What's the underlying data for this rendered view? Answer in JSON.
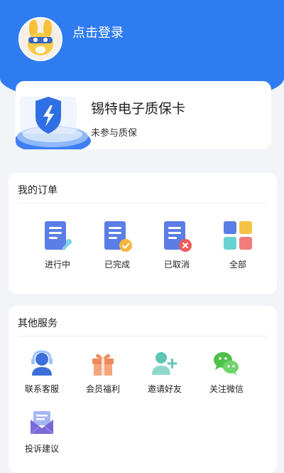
{
  "header": {
    "login_label": "点击登录",
    "accent_color": "#2f7cf0"
  },
  "warranty_card": {
    "title": "锡特电子质保卡",
    "status": "未参与质保",
    "icon": "shield-lightning-icon"
  },
  "orders": {
    "title": "我的订单",
    "items": [
      {
        "label": "进行中",
        "icon": "order-in-progress-icon"
      },
      {
        "label": "已完成",
        "icon": "order-completed-icon"
      },
      {
        "label": "已取消",
        "icon": "order-cancelled-icon"
      },
      {
        "label": "全部",
        "icon": "all-orders-icon"
      }
    ]
  },
  "services": {
    "title": "其他服务",
    "items": [
      {
        "label": "联系客服",
        "icon": "customer-service-icon"
      },
      {
        "label": "会员福利",
        "icon": "gift-icon"
      },
      {
        "label": "邀请好友",
        "icon": "invite-friend-icon"
      },
      {
        "label": "关注微信",
        "icon": "wechat-icon"
      },
      {
        "label": "投诉建议",
        "icon": "feedback-mail-icon"
      }
    ]
  }
}
